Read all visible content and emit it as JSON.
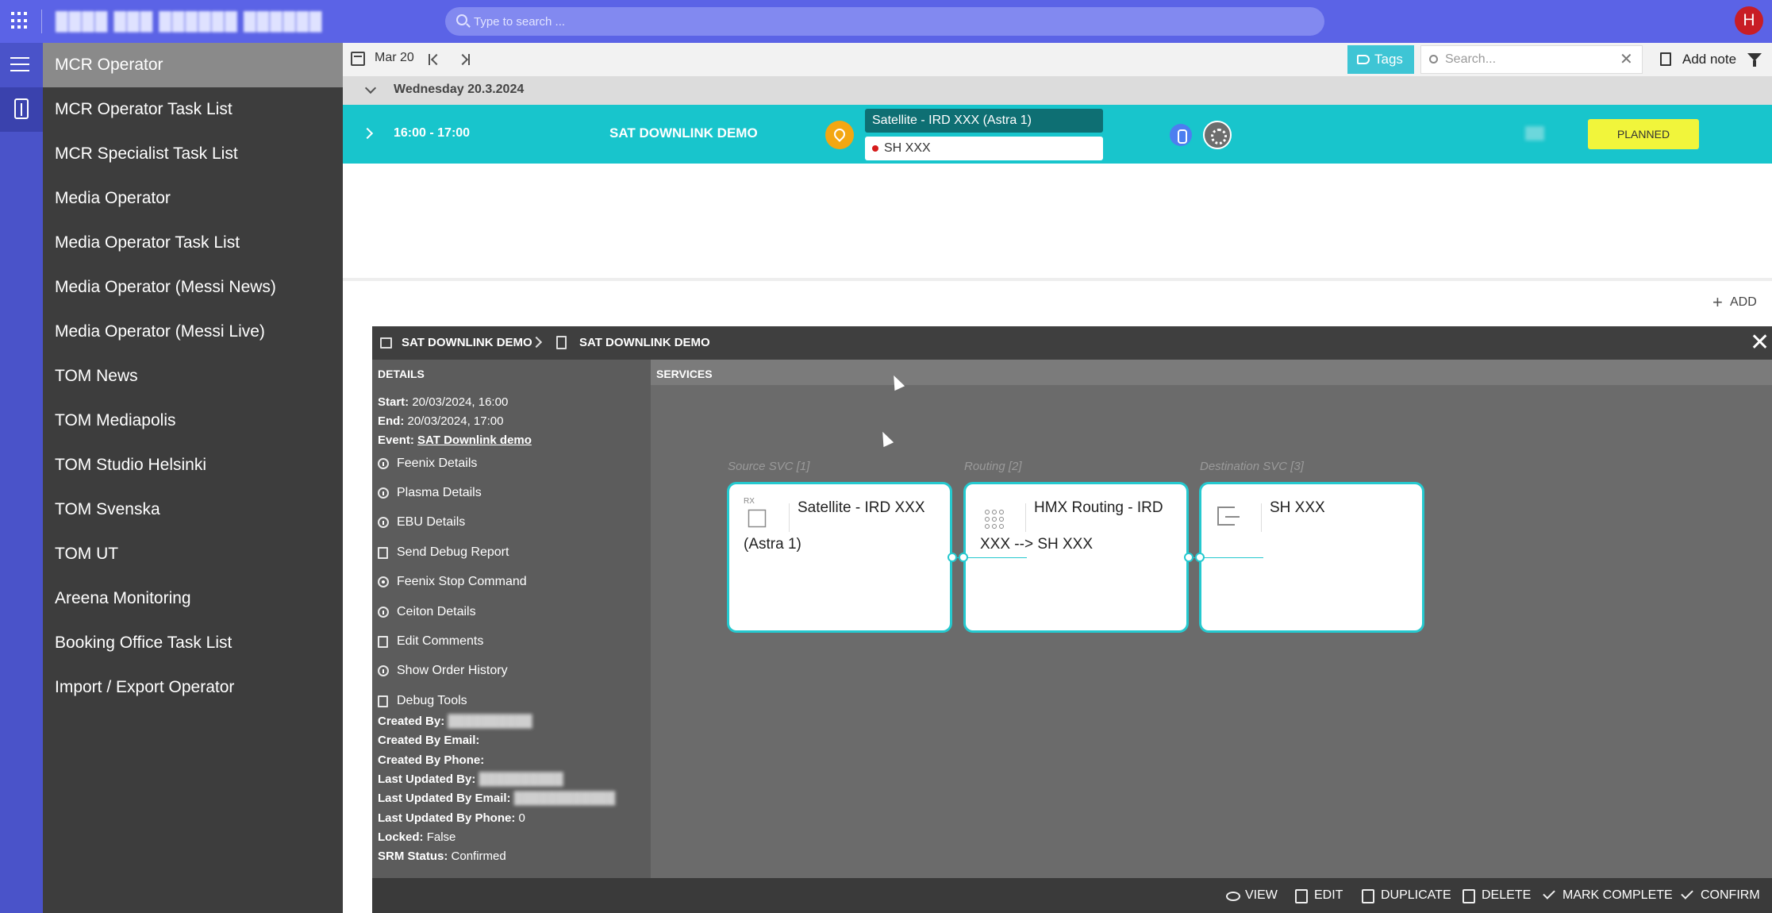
{
  "topbar": {
    "app_title": "████ ███ ██████ ██████",
    "search_placeholder": "Type to search ...",
    "user_initial": "H"
  },
  "sidebar": {
    "items": [
      {
        "label": "MCR Operator",
        "active": true
      },
      {
        "label": "MCR Operator Task List"
      },
      {
        "label": "MCR Specialist Task List"
      },
      {
        "label": "Media Operator"
      },
      {
        "label": "Media Operator Task List"
      },
      {
        "label": "Media Operator (Messi News)"
      },
      {
        "label": "Media Operator (Messi Live)"
      },
      {
        "label": "TOM News"
      },
      {
        "label": "TOM Mediapolis"
      },
      {
        "label": "TOM Studio Helsinki"
      },
      {
        "label": "TOM Svenska"
      },
      {
        "label": "TOM UT"
      },
      {
        "label": "Areena Monitoring"
      },
      {
        "label": "Booking Office Task List"
      },
      {
        "label": "Import / Export Operator"
      }
    ]
  },
  "toolbar": {
    "date": "Mar 20",
    "tags_label": "Tags",
    "search_placeholder": "Search...",
    "add_note_label": "Add note"
  },
  "schedule": {
    "day_header": "Wednesday 20.3.2024",
    "booking": {
      "time": "16:00 - 17:00",
      "name": "SAT DOWNLINK DEMO",
      "service_source": "Satellite - IRD XXX (Astra 1)",
      "service_destination": "SH XXX",
      "status": "PLANNED"
    },
    "add_label": "ADD"
  },
  "detail": {
    "breadcrumb": [
      "SAT DOWNLINK DEMO",
      "SAT DOWNLINK DEMO"
    ],
    "details_header": "DETAILS",
    "services_header": "SERVICES",
    "fields": {
      "start_label": "Start:",
      "start_value": "20/03/2024, 16:00",
      "end_label": "End:",
      "end_value": "20/03/2024, 17:00",
      "event_label": "Event:",
      "event_value": "SAT Downlink demo"
    },
    "actions": [
      "Feenix Details",
      "Plasma Details",
      "EBU Details",
      "Send Debug Report",
      "Feenix Stop Command",
      "Ceiton Details",
      "Edit Comments",
      "Show Order History",
      "Debug Tools"
    ],
    "meta": {
      "created_by_label": "Created By:",
      "created_by_value": "██████████",
      "created_by_email_label": "Created By Email:",
      "created_by_phone_label": "Created By Phone:",
      "last_updated_by_label": "Last Updated By:",
      "last_updated_by_value": "██████████",
      "last_updated_by_email_label": "Last Updated By Email:",
      "last_updated_by_email_value": "████████████",
      "last_updated_by_phone_label": "Last Updated By Phone:",
      "last_updated_by_phone_value": "0",
      "locked_label": "Locked:",
      "locked_value": "False",
      "srm_status_label": "SRM Status:",
      "srm_status_value": "Confirmed"
    },
    "services": {
      "source_label": "Source SVC [1]",
      "routing_label": "Routing [2]",
      "destination_label": "Destination SVC [3]",
      "source_card": "Satellite - IRD XXX (Astra 1)",
      "source_icon_tag": "RX",
      "routing_card": "HMX Routing - IRD XXX --> SH XXX",
      "destination_card": "SH XXX"
    },
    "footer_actions": [
      "VIEW",
      "EDIT",
      "DUPLICATE",
      "DELETE",
      "MARK COMPLETE",
      "CONFIRM"
    ]
  },
  "colors": {
    "topbar": "#5b63e6",
    "rail": "#4a53c9",
    "sidebar": "#3d3d3d",
    "booking_row": "#18c5cc",
    "planned_badge": "#f1f53b",
    "card_border": "#25c9cf"
  }
}
